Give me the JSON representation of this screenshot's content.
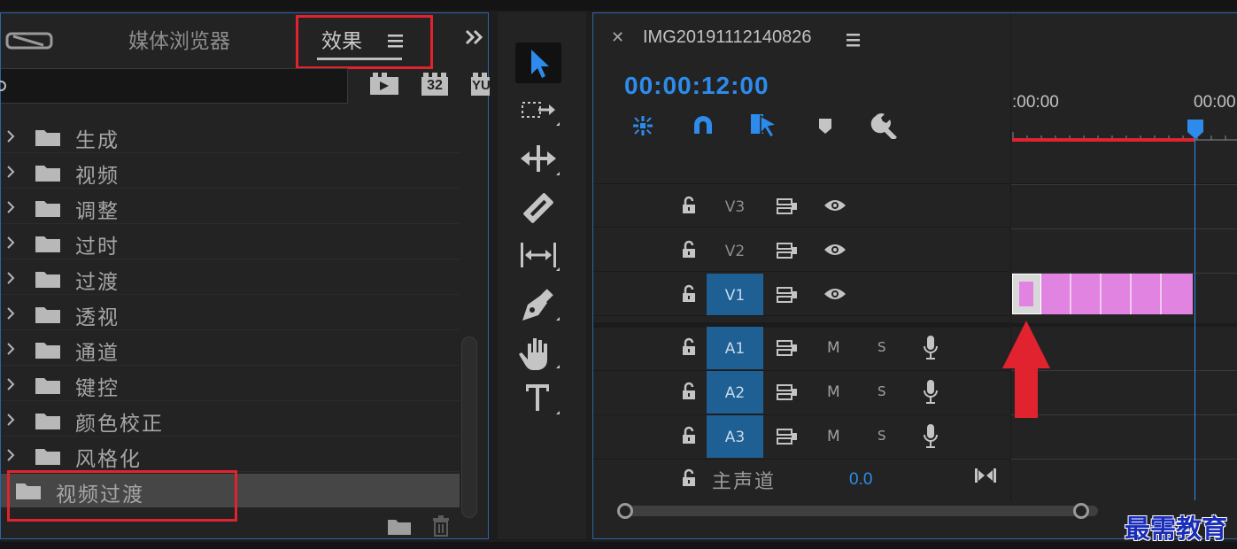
{
  "effects_panel": {
    "tabs": [
      "媒体浏览器",
      "效果"
    ],
    "active_tab": "效果",
    "search": {
      "value": "",
      "placeholder": ""
    },
    "filter_badges": [
      "32",
      "YU"
    ],
    "folders": [
      "生成",
      "视频",
      "调整",
      "过时",
      "过渡",
      "透视",
      "通道",
      "键控",
      "颜色校正",
      "风格化"
    ],
    "selected_folder": "视频过渡"
  },
  "sequence": {
    "title": "IMG20191112140826",
    "timecode": "00:00:12:00",
    "ruler_labels": [
      ":00:00",
      "00:00"
    ],
    "video_tracks": [
      "V3",
      "V2",
      "V1"
    ],
    "audio_tracks": [
      "A1",
      "A2",
      "A3"
    ],
    "mute_label": "M",
    "solo_label": "S",
    "master": {
      "label": "主声道",
      "value": "0.0"
    }
  },
  "colors": {
    "accent": "#2d8ceb",
    "highlight": "#e0232e",
    "clip": "#e183e1",
    "track_selected": "#1e5f94"
  },
  "watermark": "最需教育"
}
